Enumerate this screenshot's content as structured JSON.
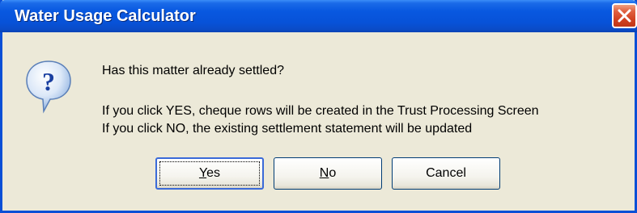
{
  "window": {
    "title": "Water Usage Calculator",
    "close_icon": "close-icon"
  },
  "message": {
    "icon": "question-icon",
    "line1": "Has this matter already settled?",
    "line2": "If you click YES, cheque rows will be created in the Trust Processing Screen",
    "line3": "If you click NO, the existing settlement statement will be updated"
  },
  "buttons": {
    "yes": {
      "first": "Y",
      "rest": "es"
    },
    "no": {
      "first": "N",
      "rest": "o"
    },
    "cancel": "Cancel"
  },
  "colors": {
    "titlebar": "#0858e0",
    "face": "#ece9d8",
    "close": "#d04020"
  }
}
